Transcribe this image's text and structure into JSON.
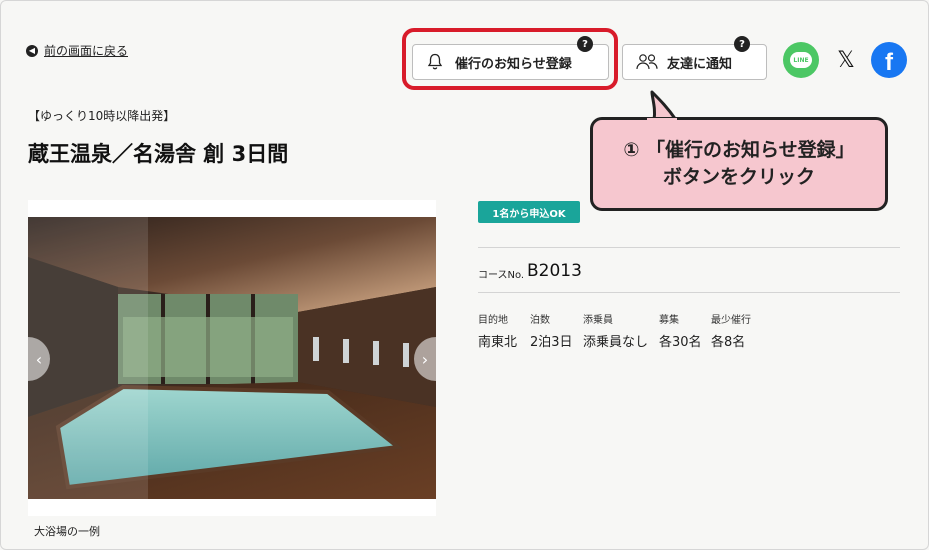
{
  "nav": {
    "back_label": "前の画面に戻る"
  },
  "header": {
    "notify_label": "催行のお知らせ登録",
    "friend_label": "友達に通知",
    "help_mark": "?",
    "sns": {
      "line_label": "LINE",
      "x_label": "𝕏",
      "facebook_label": "f"
    }
  },
  "tour": {
    "subtitle": "【ゆっくり10時以降出発】",
    "title": "蔵王温泉／名湯舎 創 3日間",
    "badge": "1名から申込OK",
    "course_label": "コースNo.",
    "course_no": "B2013",
    "specs": [
      {
        "label": "目的地",
        "value": "南東北"
      },
      {
        "label": "泊数",
        "value": "2泊3日"
      },
      {
        "label": "添乗員",
        "value": "添乗員なし"
      },
      {
        "label": "募集",
        "value": "各30名"
      },
      {
        "label": "最少催行",
        "value": "各8名"
      }
    ],
    "photo_caption": "大浴場の一例"
  },
  "callout": {
    "line1": "① 「催行のお知らせ登録」",
    "line2": "ボタンをクリック"
  },
  "colors": {
    "highlight": "#d81b2a",
    "callout_bg": "#f6c7cf",
    "badge": "#1aa59a",
    "line_green": "#4cc764",
    "facebook_blue": "#1877f2"
  }
}
